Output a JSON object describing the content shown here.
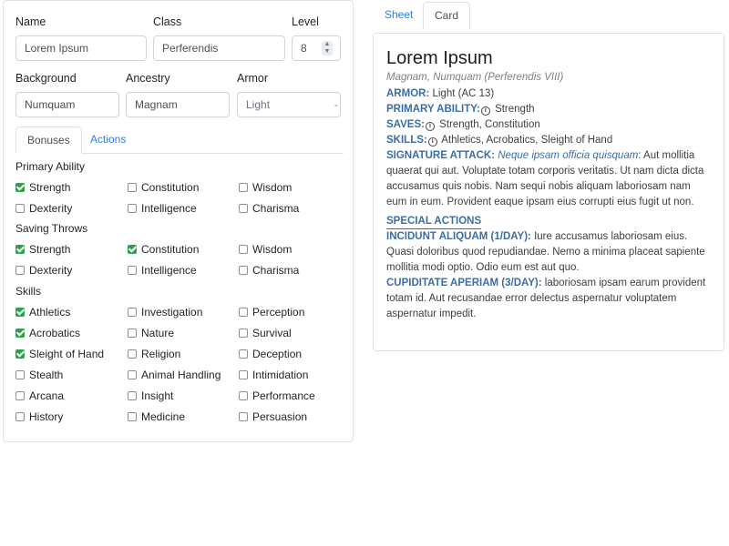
{
  "form": {
    "name_label": "Name",
    "name_value": "Lorem Ipsum",
    "class_label": "Class",
    "class_value": "Perferendis",
    "level_label": "Level",
    "level_value": "8",
    "background_label": "Background",
    "background_value": "Numquam",
    "ancestry_label": "Ancestry",
    "ancestry_value": "Magnam",
    "armor_label": "Armor",
    "armor_value": "Light",
    "armor_caret": "-"
  },
  "left_tabs": [
    "Bonuses",
    "Actions"
  ],
  "sections": {
    "primary_ability": {
      "title": "Primary Ability",
      "items": [
        {
          "label": "Strength",
          "checked": true
        },
        {
          "label": "Constitution",
          "checked": false
        },
        {
          "label": "Wisdom",
          "checked": false
        },
        {
          "label": "Dexterity",
          "checked": false
        },
        {
          "label": "Intelligence",
          "checked": false
        },
        {
          "label": "Charisma",
          "checked": false
        }
      ]
    },
    "saving_throws": {
      "title": "Saving Throws",
      "items": [
        {
          "label": "Strength",
          "checked": true
        },
        {
          "label": "Constitution",
          "checked": true
        },
        {
          "label": "Wisdom",
          "checked": false
        },
        {
          "label": "Dexterity",
          "checked": false
        },
        {
          "label": "Intelligence",
          "checked": false
        },
        {
          "label": "Charisma",
          "checked": false
        }
      ]
    },
    "skills": {
      "title": "Skills",
      "items": [
        {
          "label": "Athletics",
          "checked": true
        },
        {
          "label": "Investigation",
          "checked": false
        },
        {
          "label": "Perception",
          "checked": false
        },
        {
          "label": "Acrobatics",
          "checked": true
        },
        {
          "label": "Nature",
          "checked": false
        },
        {
          "label": "Survival",
          "checked": false
        },
        {
          "label": "Sleight of Hand",
          "checked": true
        },
        {
          "label": "Religion",
          "checked": false
        },
        {
          "label": "Deception",
          "checked": false
        },
        {
          "label": "Stealth",
          "checked": false
        },
        {
          "label": "Animal Handling",
          "checked": false
        },
        {
          "label": "Intimidation",
          "checked": false
        },
        {
          "label": "Arcana",
          "checked": false
        },
        {
          "label": "Insight",
          "checked": false
        },
        {
          "label": "Performance",
          "checked": false
        },
        {
          "label": "History",
          "checked": false
        },
        {
          "label": "Medicine",
          "checked": false
        },
        {
          "label": "Persuasion",
          "checked": false
        }
      ]
    }
  },
  "right_tabs": [
    "Sheet",
    "Card"
  ],
  "card": {
    "name": "Lorem Ipsum",
    "subtitle": "Magnam, Numquam (Perferendis VIII)",
    "armor_kw": "ARMOR:",
    "armor_text": " Light (AC 13)",
    "primary_kw": "PRIMARY ABILITY:",
    "primary_text": " Strength",
    "saves_kw": "SAVES:",
    "saves_text": " Strength, Constitution",
    "skills_kw": "SKILLS:",
    "skills_text": " Athletics, Acrobatics, Sleight of Hand",
    "info_glyph": "i",
    "sig_kw": "SIGNATURE ATTACK:",
    "sig_name": " Neque ipsam officia quisquam",
    "sig_text": ": Aut mollitia quaerat qui aut. Voluptate totam corporis veritatis. Ut nam dicta dicta accusamus quis nobis. Nam sequi nobis aliquam laboriosam nam eum in eum. Provident eaque ipsam eius corrupti eius fugit ut non.",
    "special_title": "SPECIAL ACTIONS",
    "action1_kw": "INCIDUNT ALIQUAM (1/DAY):",
    "action1_text": " Iure accusamus laboriosam eius. Quasi doloribus quod repudiandae. Nemo a minima placeat sapiente mollitia modi optio. Odio eum est aut quo.",
    "action2_kw": "CUPIDITATE APERIAM (3/DAY):",
    "action2_text": " laboriosam ipsam earum provident totam id. Aut recusandae error delectus aspernatur voluptatem aspernatur impedit."
  },
  "colors": {
    "accent": "#2b7de9",
    "keyword": "#3a6ea5",
    "checkbox_checked": "#2aa34a"
  }
}
